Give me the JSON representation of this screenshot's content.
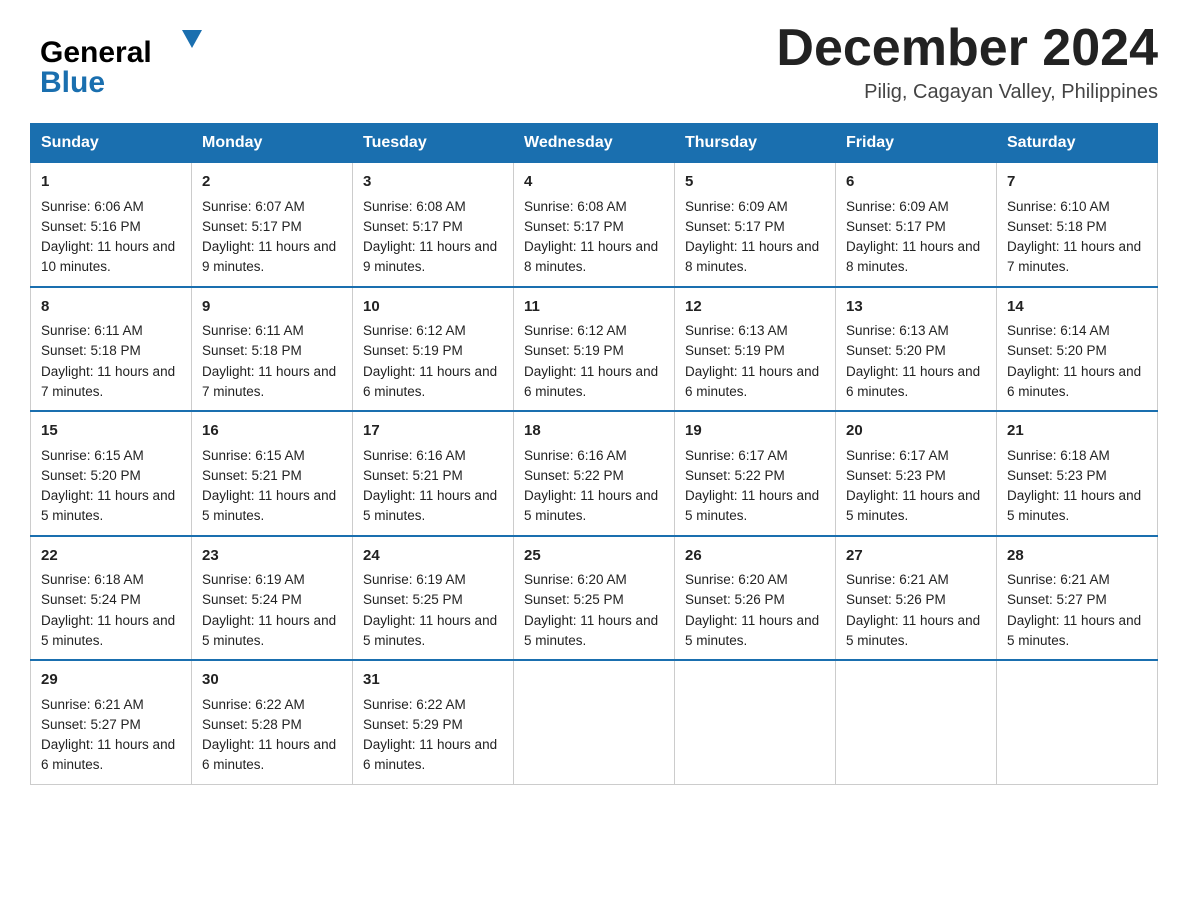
{
  "header": {
    "logo_general": "General",
    "logo_blue": "Blue",
    "title": "December 2024",
    "location": "Pilig, Cagayan Valley, Philippines"
  },
  "weekdays": [
    "Sunday",
    "Monday",
    "Tuesday",
    "Wednesday",
    "Thursday",
    "Friday",
    "Saturday"
  ],
  "weeks": [
    [
      {
        "day": "1",
        "sunrise": "6:06 AM",
        "sunset": "5:16 PM",
        "daylight": "11 hours and 10 minutes."
      },
      {
        "day": "2",
        "sunrise": "6:07 AM",
        "sunset": "5:17 PM",
        "daylight": "11 hours and 9 minutes."
      },
      {
        "day": "3",
        "sunrise": "6:08 AM",
        "sunset": "5:17 PM",
        "daylight": "11 hours and 9 minutes."
      },
      {
        "day": "4",
        "sunrise": "6:08 AM",
        "sunset": "5:17 PM",
        "daylight": "11 hours and 8 minutes."
      },
      {
        "day": "5",
        "sunrise": "6:09 AM",
        "sunset": "5:17 PM",
        "daylight": "11 hours and 8 minutes."
      },
      {
        "day": "6",
        "sunrise": "6:09 AM",
        "sunset": "5:17 PM",
        "daylight": "11 hours and 8 minutes."
      },
      {
        "day": "7",
        "sunrise": "6:10 AM",
        "sunset": "5:18 PM",
        "daylight": "11 hours and 7 minutes."
      }
    ],
    [
      {
        "day": "8",
        "sunrise": "6:11 AM",
        "sunset": "5:18 PM",
        "daylight": "11 hours and 7 minutes."
      },
      {
        "day": "9",
        "sunrise": "6:11 AM",
        "sunset": "5:18 PM",
        "daylight": "11 hours and 7 minutes."
      },
      {
        "day": "10",
        "sunrise": "6:12 AM",
        "sunset": "5:19 PM",
        "daylight": "11 hours and 6 minutes."
      },
      {
        "day": "11",
        "sunrise": "6:12 AM",
        "sunset": "5:19 PM",
        "daylight": "11 hours and 6 minutes."
      },
      {
        "day": "12",
        "sunrise": "6:13 AM",
        "sunset": "5:19 PM",
        "daylight": "11 hours and 6 minutes."
      },
      {
        "day": "13",
        "sunrise": "6:13 AM",
        "sunset": "5:20 PM",
        "daylight": "11 hours and 6 minutes."
      },
      {
        "day": "14",
        "sunrise": "6:14 AM",
        "sunset": "5:20 PM",
        "daylight": "11 hours and 6 minutes."
      }
    ],
    [
      {
        "day": "15",
        "sunrise": "6:15 AM",
        "sunset": "5:20 PM",
        "daylight": "11 hours and 5 minutes."
      },
      {
        "day": "16",
        "sunrise": "6:15 AM",
        "sunset": "5:21 PM",
        "daylight": "11 hours and 5 minutes."
      },
      {
        "day": "17",
        "sunrise": "6:16 AM",
        "sunset": "5:21 PM",
        "daylight": "11 hours and 5 minutes."
      },
      {
        "day": "18",
        "sunrise": "6:16 AM",
        "sunset": "5:22 PM",
        "daylight": "11 hours and 5 minutes."
      },
      {
        "day": "19",
        "sunrise": "6:17 AM",
        "sunset": "5:22 PM",
        "daylight": "11 hours and 5 minutes."
      },
      {
        "day": "20",
        "sunrise": "6:17 AM",
        "sunset": "5:23 PM",
        "daylight": "11 hours and 5 minutes."
      },
      {
        "day": "21",
        "sunrise": "6:18 AM",
        "sunset": "5:23 PM",
        "daylight": "11 hours and 5 minutes."
      }
    ],
    [
      {
        "day": "22",
        "sunrise": "6:18 AM",
        "sunset": "5:24 PM",
        "daylight": "11 hours and 5 minutes."
      },
      {
        "day": "23",
        "sunrise": "6:19 AM",
        "sunset": "5:24 PM",
        "daylight": "11 hours and 5 minutes."
      },
      {
        "day": "24",
        "sunrise": "6:19 AM",
        "sunset": "5:25 PM",
        "daylight": "11 hours and 5 minutes."
      },
      {
        "day": "25",
        "sunrise": "6:20 AM",
        "sunset": "5:25 PM",
        "daylight": "11 hours and 5 minutes."
      },
      {
        "day": "26",
        "sunrise": "6:20 AM",
        "sunset": "5:26 PM",
        "daylight": "11 hours and 5 minutes."
      },
      {
        "day": "27",
        "sunrise": "6:21 AM",
        "sunset": "5:26 PM",
        "daylight": "11 hours and 5 minutes."
      },
      {
        "day": "28",
        "sunrise": "6:21 AM",
        "sunset": "5:27 PM",
        "daylight": "11 hours and 5 minutes."
      }
    ],
    [
      {
        "day": "29",
        "sunrise": "6:21 AM",
        "sunset": "5:27 PM",
        "daylight": "11 hours and 6 minutes."
      },
      {
        "day": "30",
        "sunrise": "6:22 AM",
        "sunset": "5:28 PM",
        "daylight": "11 hours and 6 minutes."
      },
      {
        "day": "31",
        "sunrise": "6:22 AM",
        "sunset": "5:29 PM",
        "daylight": "11 hours and 6 minutes."
      },
      null,
      null,
      null,
      null
    ]
  ]
}
